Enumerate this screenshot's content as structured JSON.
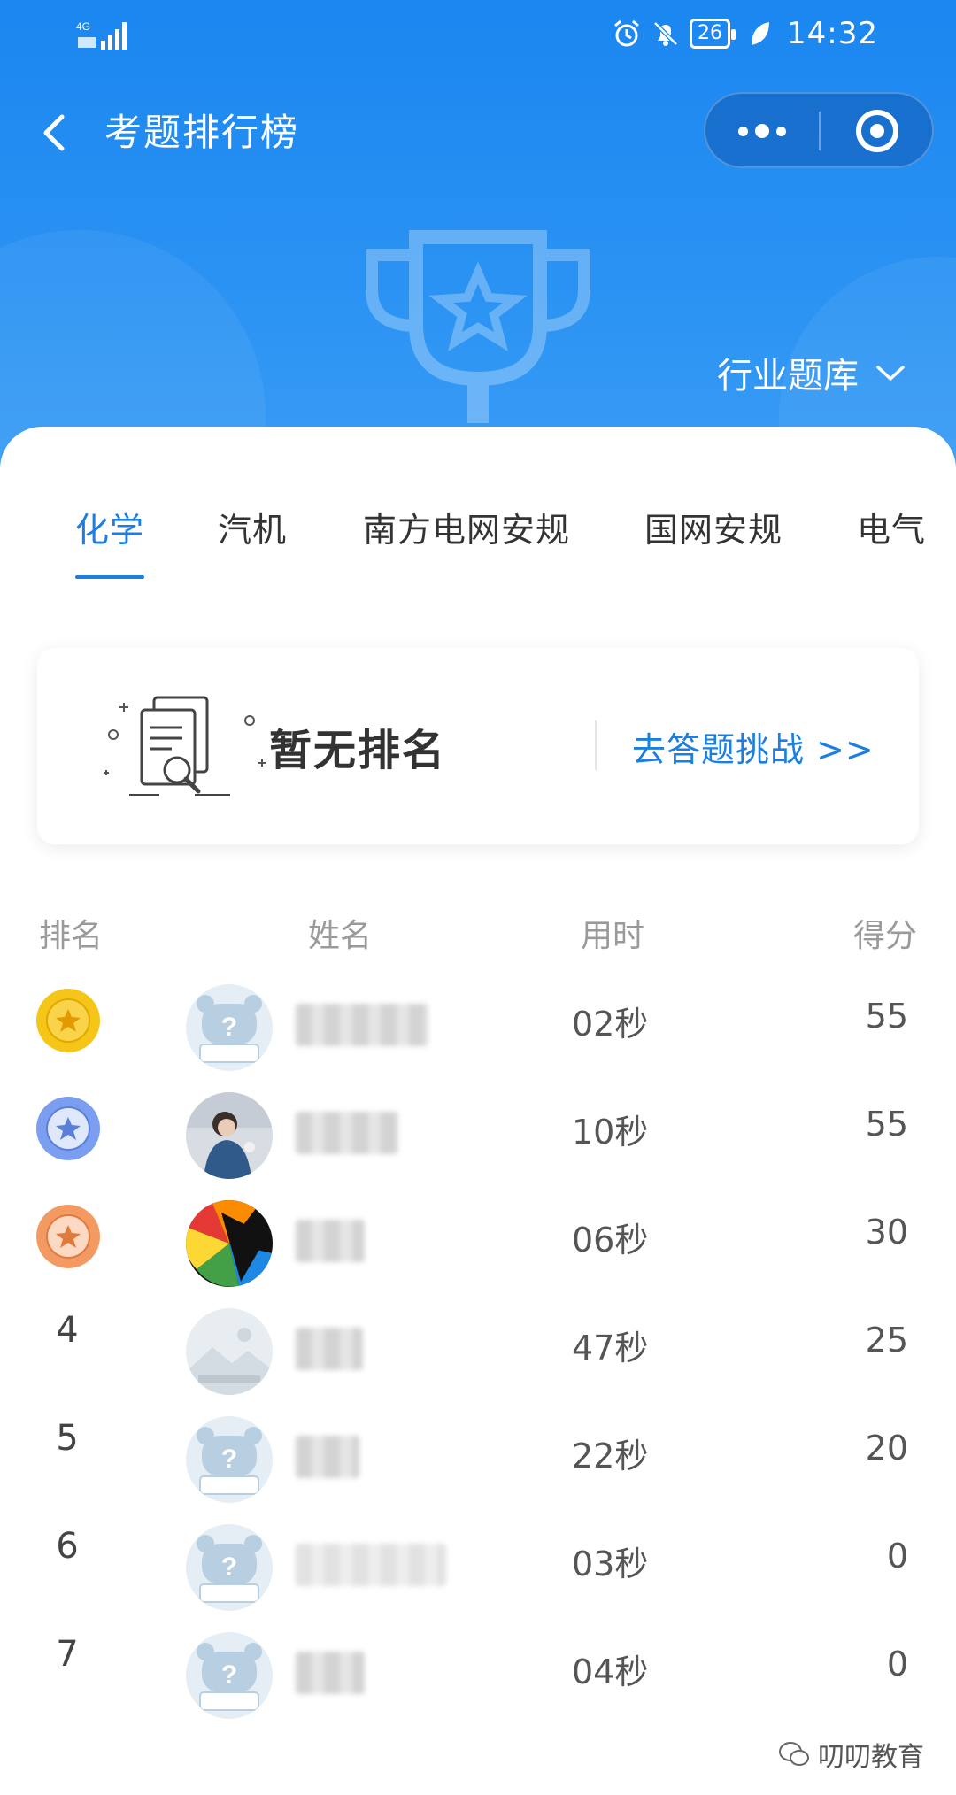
{
  "status_bar": {
    "network": "4G",
    "battery": "26",
    "time": "14:32"
  },
  "nav": {
    "title": "考题排行榜"
  },
  "header": {
    "industry_label": "行业题库"
  },
  "tabs": [
    {
      "label": "化学",
      "active": true
    },
    {
      "label": "汽机",
      "active": false
    },
    {
      "label": "南方电网安规",
      "active": false
    },
    {
      "label": "国网安规",
      "active": false
    },
    {
      "label": "电气",
      "active": false
    }
  ],
  "my_rank": {
    "status": "暂无排名",
    "action": "去答题挑战 >>"
  },
  "table": {
    "headers": {
      "rank": "排名",
      "name": "姓名",
      "time": "用时",
      "score": "得分"
    },
    "rows": [
      {
        "rank": "1",
        "medal": "gold",
        "avatar": "default-avatar",
        "time": "02秒",
        "score": "55"
      },
      {
        "rank": "2",
        "medal": "silver",
        "avatar": "photo-avatar",
        "time": "10秒",
        "score": "55"
      },
      {
        "rank": "3",
        "medal": "bronze",
        "avatar": "colorful-avatar",
        "time": "06秒",
        "score": "30"
      },
      {
        "rank": "4",
        "medal": "",
        "avatar": "placeholder-avatar",
        "time": "47秒",
        "score": "25"
      },
      {
        "rank": "5",
        "medal": "",
        "avatar": "default-avatar",
        "time": "22秒",
        "score": "20"
      },
      {
        "rank": "6",
        "medal": "",
        "avatar": "default-avatar",
        "time": "03秒",
        "score": "0"
      },
      {
        "rank": "7",
        "medal": "",
        "avatar": "default-avatar",
        "time": "04秒",
        "score": "0"
      }
    ]
  },
  "watermark": "叨叨教育",
  "colors": {
    "primary": "#1a7fe0",
    "header_blue": "#2b93f3",
    "gold": "#f5c518",
    "silver": "#6f95e6",
    "bronze": "#f39a63"
  }
}
